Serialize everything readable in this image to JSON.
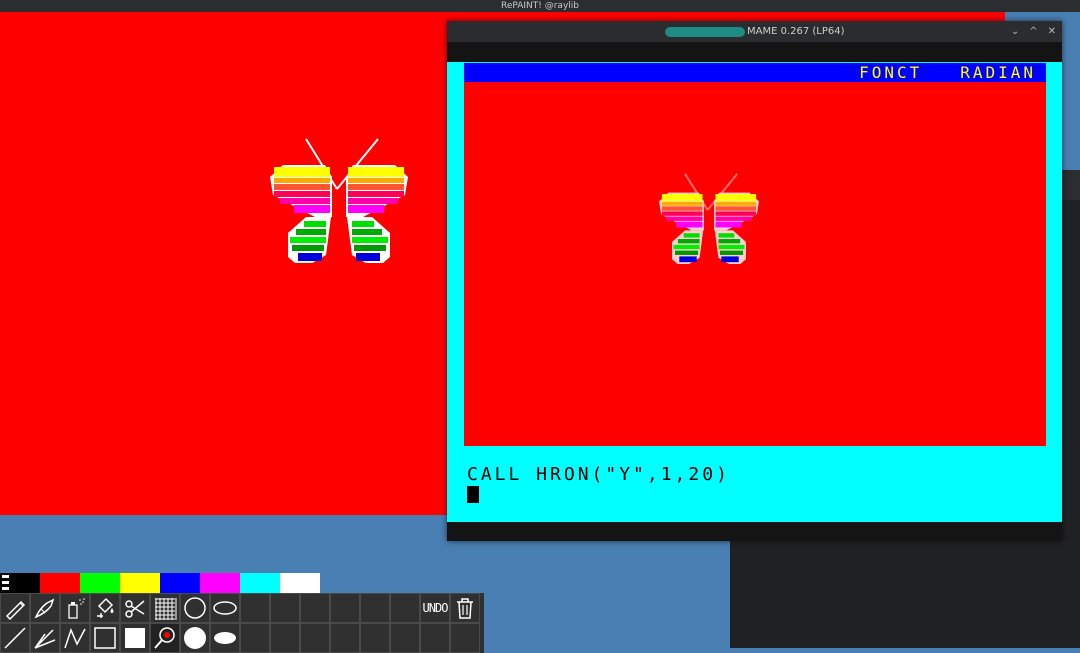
{
  "app": {
    "title": "RePAINT! @raylib"
  },
  "mame": {
    "title": "MAME 0.267 (LP64)",
    "window_buttons": {
      "minimize": "⌄",
      "maximize": "^",
      "close": "✕"
    },
    "status_bar": "FONCT   RADIAN",
    "command": "CALL HRON(\"Y\",1,20)"
  },
  "palette": {
    "colors": [
      "#000000",
      "#ff0000",
      "#00ff00",
      "#ffff00",
      "#0000ff",
      "#ff00ff",
      "#00ffff",
      "#ffffff"
    ],
    "selected": "#ff0000"
  },
  "toolbar": {
    "undo_label": "UNDO",
    "row1": [
      "pencil-icon",
      "brush-icon",
      "spray-can-icon",
      "fill-bucket-icon",
      "scissors-icon",
      "grid-icon",
      "circle-outline-icon",
      "ellipse-outline-icon"
    ],
    "row2": [
      "line-icon",
      "polyline-icon",
      "zigzag-icon",
      "rectangle-outline-icon",
      "rectangle-filled-icon",
      "magnifier-icon",
      "circle-filled-icon",
      "ellipse-filled-icon"
    ],
    "trash_icon": "trash-icon"
  },
  "colors": {
    "canvas_bg": "#ff0000",
    "mame_screen_border": "#00ffff",
    "mame_status_bar": "#0000ff",
    "mame_status_text": "#ffff00",
    "desktop_bg": "#4a7fb3"
  }
}
